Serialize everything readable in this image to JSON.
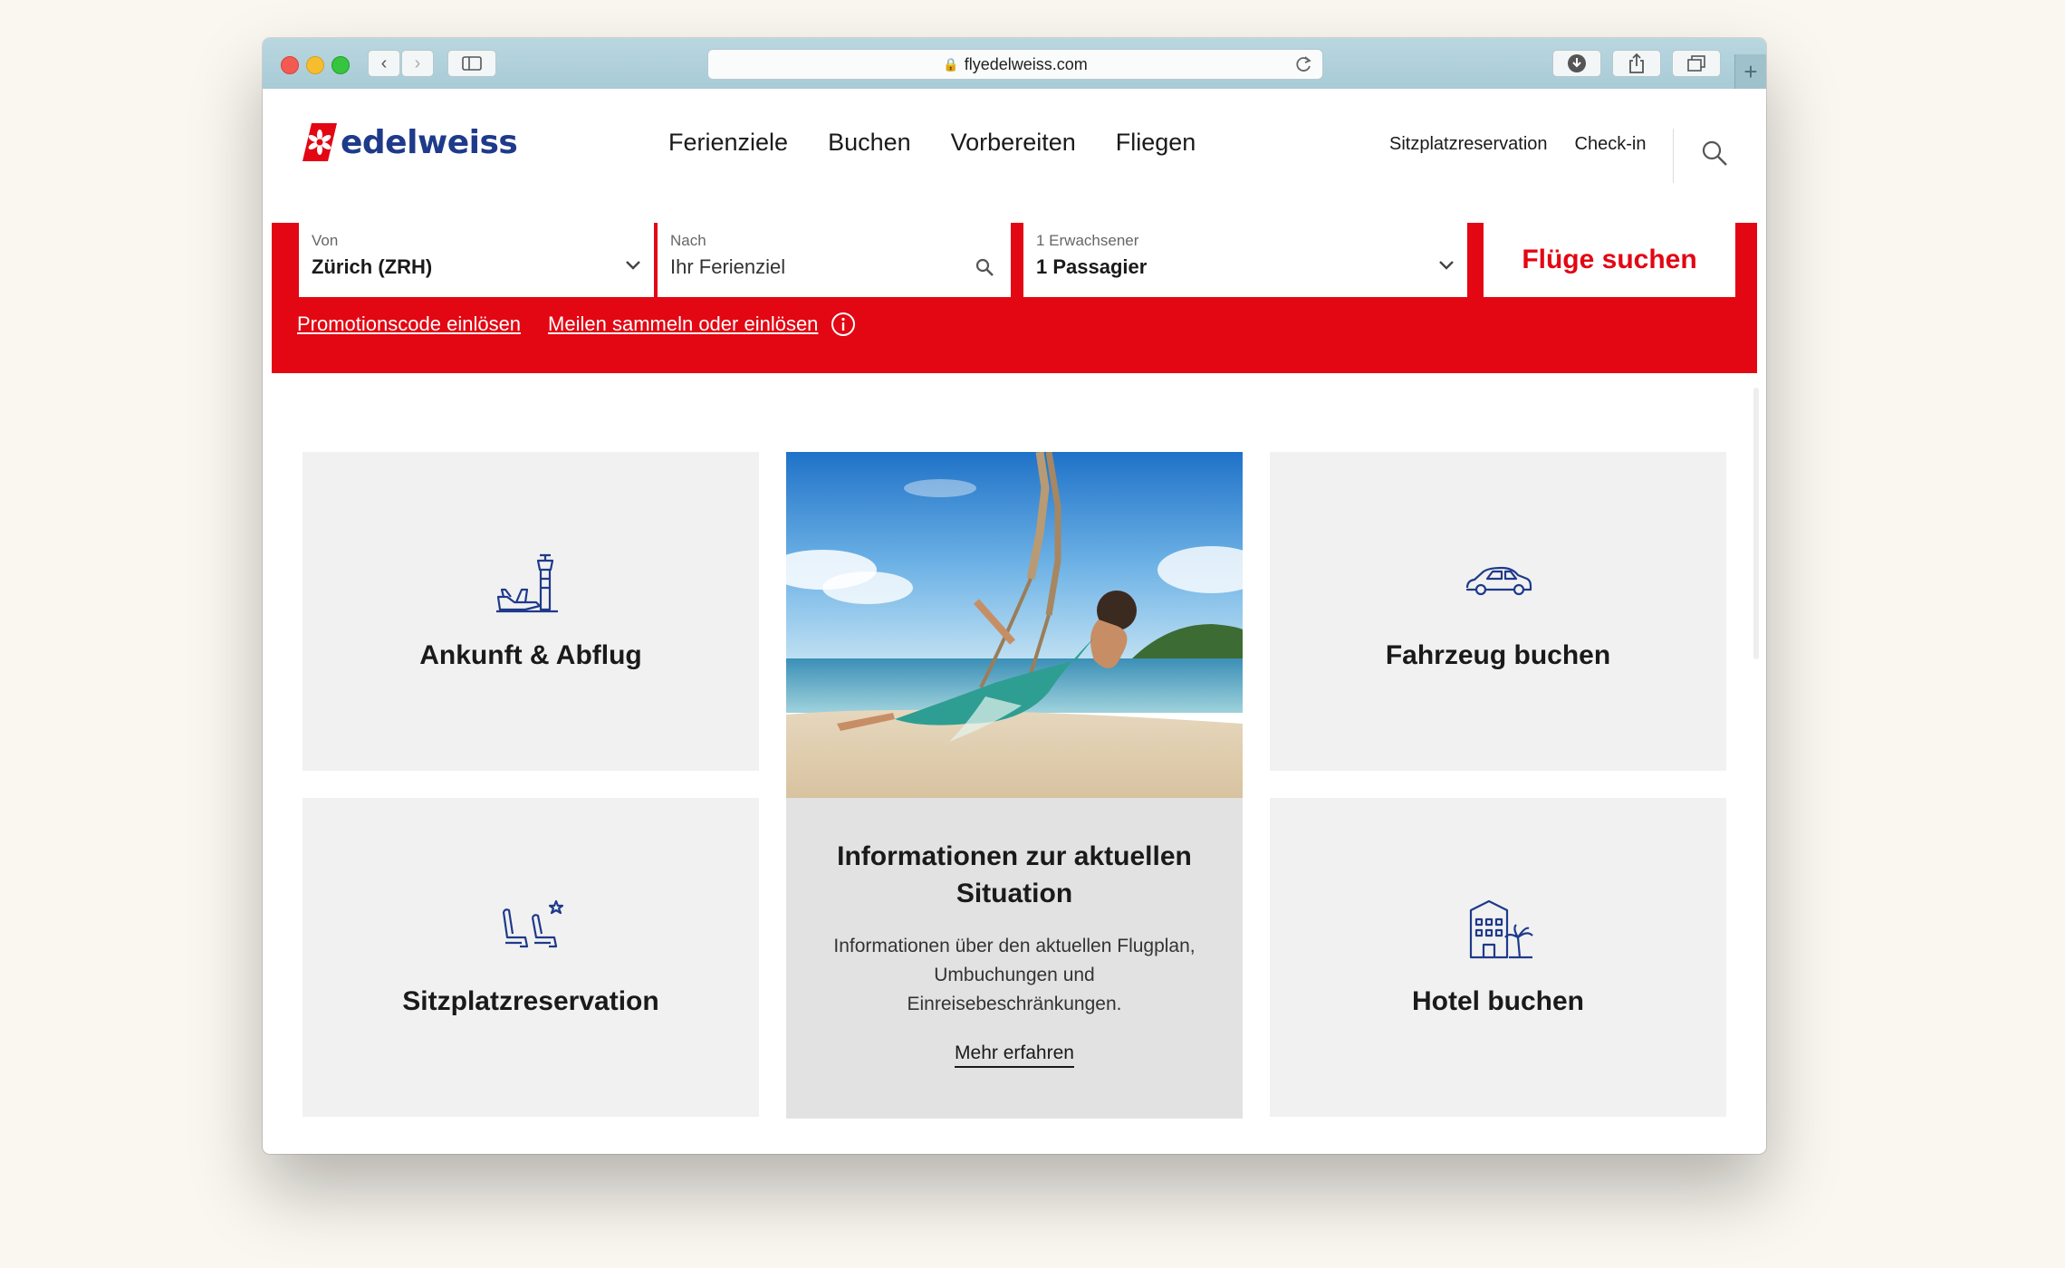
{
  "browser": {
    "url": "flyedelweiss.com",
    "lock_glyph": "🔒",
    "back_glyph": "‹",
    "forward_glyph": "›",
    "newtab_glyph": "+"
  },
  "header": {
    "logo_text": "edelweiss",
    "nav": [
      "Ferienziele",
      "Buchen",
      "Vorbereiten",
      "Fliegen"
    ],
    "meta": [
      "Sitzplatzreservation",
      "Check-in"
    ]
  },
  "booking": {
    "from": {
      "label": "Von",
      "value": "Zürich (ZRH)"
    },
    "to": {
      "label": "Nach",
      "placeholder": "Ihr Ferienziel"
    },
    "pax": {
      "label": "1 Erwachsener",
      "value": "1 Passagier"
    },
    "search_label": "Flüge suchen",
    "links": [
      "Promotionscode einlösen",
      "Meilen sammeln oder einlösen"
    ]
  },
  "tiles": {
    "arrival": "Ankunft & Abflug",
    "vehicle": "Fahrzeug buchen",
    "seat": "Sitzplatzreservation",
    "hotel": "Hotel buchen"
  },
  "promo": {
    "title": "Informationen zur aktuellen Situation",
    "text": "Informationen über den aktuellen Flug­plan, Umbuchungen und Einreisebeschränkungen.",
    "link": "Mehr erfahren"
  },
  "colors": {
    "brand_red": "#e30613",
    "brand_blue": "#1e3a8a",
    "tile_bg": "#f1f1f1",
    "promo_bg": "#e2e2e2"
  },
  "icons": [
    "search-icon",
    "chevron-down-icon",
    "info-icon",
    "airport-tower-icon",
    "car-icon",
    "seats-star-icon",
    "hotel-palm-icon",
    "edelweiss-flower-icon"
  ]
}
